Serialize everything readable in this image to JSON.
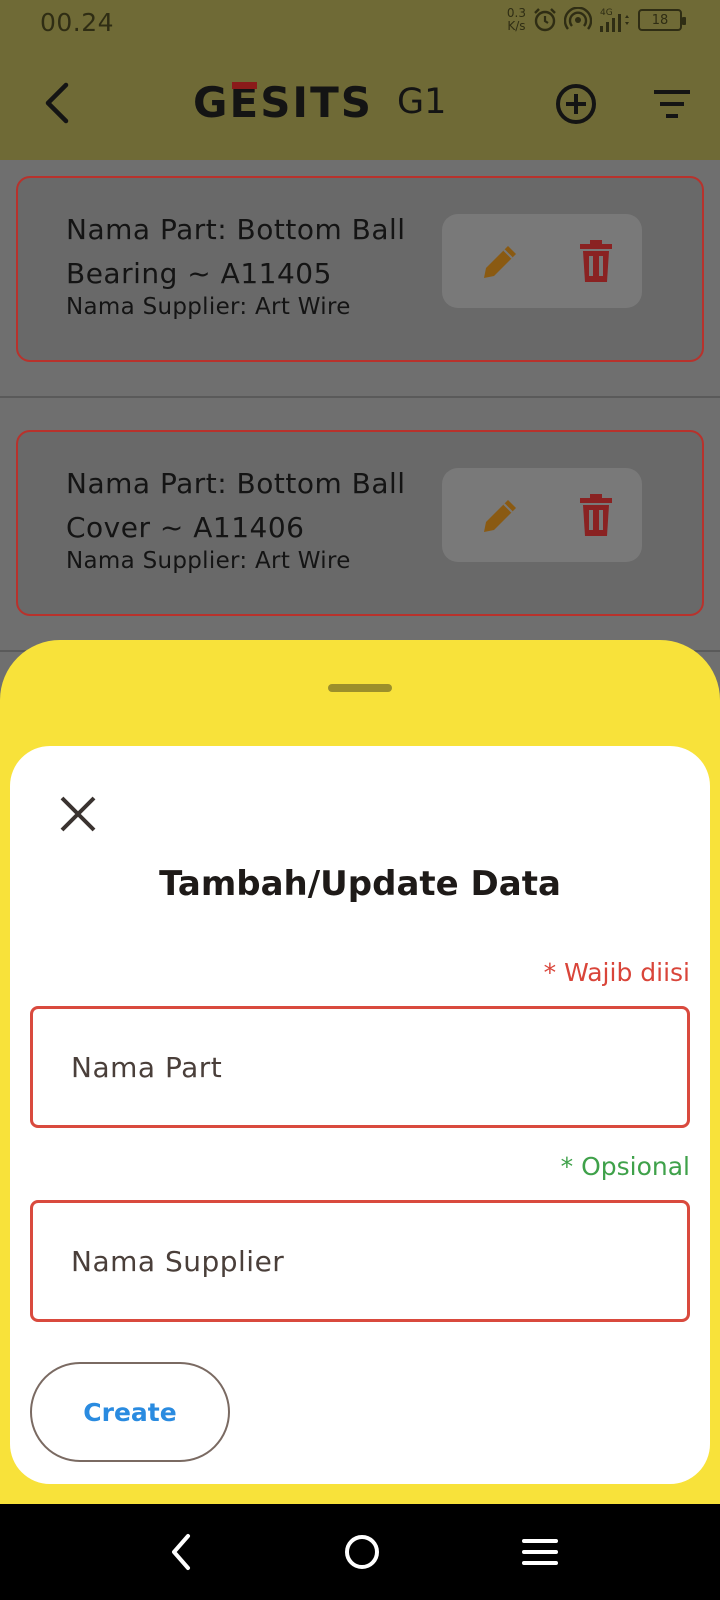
{
  "status_bar": {
    "time": "00.24",
    "net_speed_value": "0.3",
    "net_speed_unit": "K/s",
    "network_type": "4G",
    "battery": "18"
  },
  "app_bar": {
    "logo_text_1": "G",
    "logo_text_2": "E",
    "logo_text_3": "SITS",
    "title": "G1",
    "icons": [
      "back-arrow-icon",
      "add-circle-icon",
      "filter-icon"
    ]
  },
  "list": {
    "items": [
      {
        "part_line1": "Nama Part: Bottom Ball",
        "part_line2": "Bearing ~ A11405",
        "supplier": "Nama Supplier: Art Wire"
      },
      {
        "part_line1": "Nama Part: Bottom Ball",
        "part_line2": "Cover ~ A11406",
        "supplier": "Nama Supplier: Art Wire"
      }
    ]
  },
  "dialog": {
    "title": "Tambah/Update Data",
    "required_label": "* Wajib diisi",
    "optional_label": "* Opsional",
    "part_placeholder": "Nama Part",
    "supplier_placeholder": "Nama Supplier",
    "create_label": "Create"
  },
  "colors": {
    "app_bar": "#6f6a36",
    "sheet": "#f8e23a",
    "card_border": "#b8322c",
    "required": "#d9453a",
    "optional": "#3fa14a",
    "button_text": "#2a8be0"
  }
}
